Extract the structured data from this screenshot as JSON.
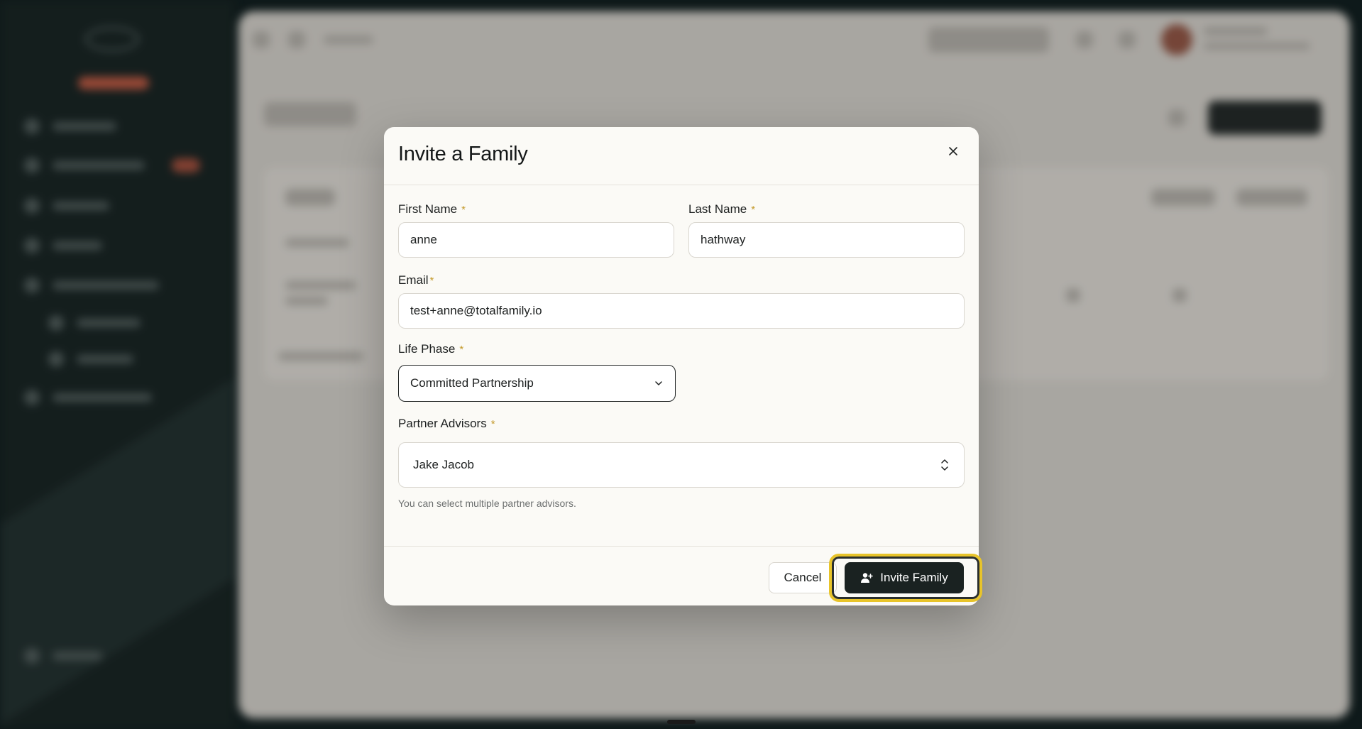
{
  "modal": {
    "title": "Invite a Family",
    "close_icon": "close-icon",
    "first_name": {
      "label": "First Name",
      "required_mark": "*",
      "value": "anne"
    },
    "last_name": {
      "label": "Last Name",
      "required_mark": "*",
      "value": "hathway"
    },
    "email": {
      "label": "Email",
      "required_mark": "*",
      "value": "test+anne@totalfamily.io"
    },
    "life_phase": {
      "label": "Life Phase",
      "required_mark": "*",
      "value": "Committed Partnership",
      "icon": "chevron-down-icon"
    },
    "partner_advisors": {
      "label": "Partner Advisors",
      "required_mark": "*",
      "value": "Jake Jacob",
      "icon": "chevron-up-down-icon",
      "helper": "You can select multiple partner advisors."
    },
    "footer": {
      "cancel_label": "Cancel",
      "invite_label": "Invite Family",
      "invite_icon": "user-plus-icon"
    }
  },
  "colors": {
    "required": "#c49a2c",
    "primary_button": "#1a2221",
    "focus_ring": "#e8c42a",
    "modal_bg": "#fbfaf6"
  }
}
